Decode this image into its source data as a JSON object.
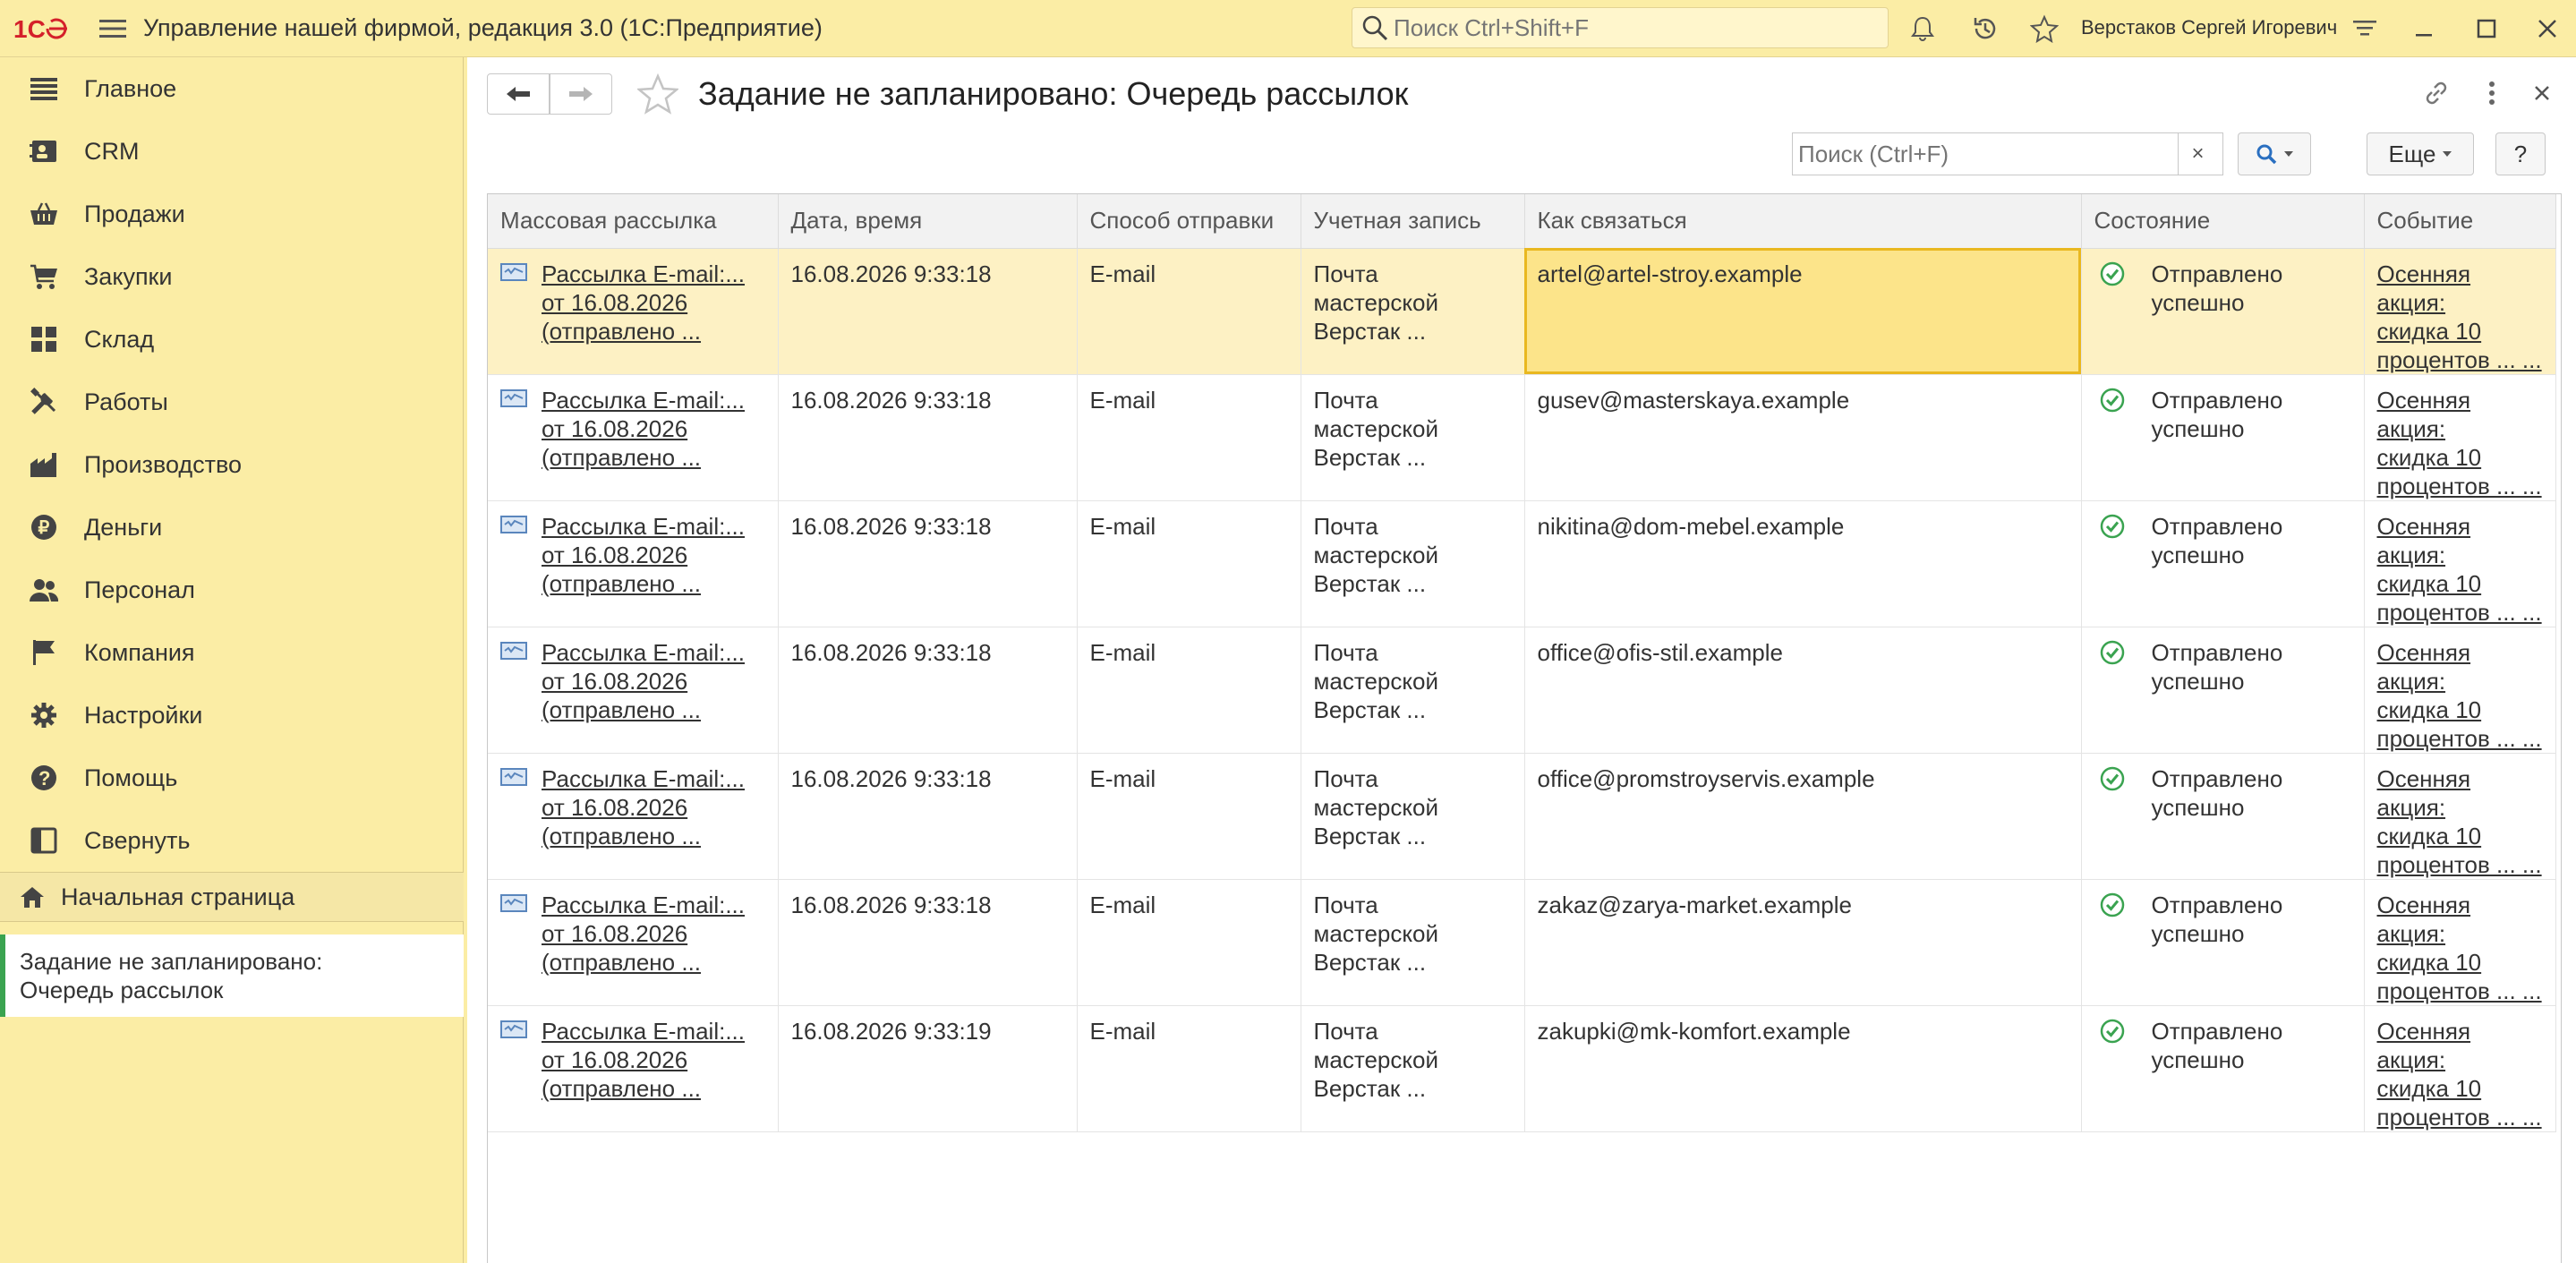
{
  "app": {
    "logo": "1С",
    "title": "Управление нашей фирмой, редакция 3.0  (1С:Предприятие)",
    "search_placeholder": "Поиск Ctrl+Shift+F",
    "user": "Верстаков Сергей Игоревич"
  },
  "sidebar": {
    "items": [
      {
        "label": "Главное",
        "icon": "menu-lines-icon"
      },
      {
        "label": "CRM",
        "icon": "contacts-icon"
      },
      {
        "label": "Продажи",
        "icon": "basket-icon"
      },
      {
        "label": "Закупки",
        "icon": "cart-icon"
      },
      {
        "label": "Склад",
        "icon": "warehouse-grid-icon"
      },
      {
        "label": "Работы",
        "icon": "tools-icon"
      },
      {
        "label": "Производство",
        "icon": "factory-icon"
      },
      {
        "label": "Деньги",
        "icon": "ruble-coin-icon"
      },
      {
        "label": "Персонал",
        "icon": "people-icon"
      },
      {
        "label": "Компания",
        "icon": "flag-icon"
      },
      {
        "label": "Настройки",
        "icon": "gear-icon"
      },
      {
        "label": "Помощь",
        "icon": "help-icon"
      },
      {
        "label": "Свернуть",
        "icon": "collapse-panel-icon"
      }
    ],
    "home": "Начальная страница",
    "open_window": {
      "line1": "Задание не запланировано:",
      "line2": "Очередь рассылок"
    }
  },
  "form": {
    "title": "Задание не запланировано: Очередь рассылок",
    "search_placeholder": "Поиск (Ctrl+F)",
    "clear": "×",
    "more_label": "Еще",
    "help_label": "?"
  },
  "columns": [
    "Массовая рассылка",
    "Дата, время",
    "Способ отправки",
    "Учетная запись",
    "Как связаться",
    "Состояние",
    "Событие"
  ],
  "rows": [
    {
      "mailing": [
        "Рассылка E-mail:...",
        "от 16.08.2026",
        "(отправлено ..."
      ],
      "datetime": "16.08.2026 9:33:18",
      "method": "E-mail",
      "account": [
        "Почта",
        "мастерской",
        "Верстак ..."
      ],
      "contact": "artel@artel-stroy.example",
      "status": [
        "Отправлено",
        "успешно"
      ],
      "event": [
        "Осенняя акция:",
        "скидка 10",
        "процентов ... ..."
      ]
    },
    {
      "mailing": [
        "Рассылка E-mail:...",
        "от 16.08.2026",
        "(отправлено ..."
      ],
      "datetime": "16.08.2026 9:33:18",
      "method": "E-mail",
      "account": [
        "Почта",
        "мастерской",
        "Верстак ..."
      ],
      "contact": "gusev@masterskaya.example",
      "status": [
        "Отправлено",
        "успешно"
      ],
      "event": [
        "Осенняя акция:",
        "скидка 10",
        "процентов ... ..."
      ]
    },
    {
      "mailing": [
        "Рассылка E-mail:...",
        "от 16.08.2026",
        "(отправлено ..."
      ],
      "datetime": "16.08.2026 9:33:18",
      "method": "E-mail",
      "account": [
        "Почта",
        "мастерской",
        "Верстак ..."
      ],
      "contact": "nikitina@dom-mebel.example",
      "status": [
        "Отправлено",
        "успешно"
      ],
      "event": [
        "Осенняя акция:",
        "скидка 10",
        "процентов ... ..."
      ]
    },
    {
      "mailing": [
        "Рассылка E-mail:...",
        "от 16.08.2026",
        "(отправлено ..."
      ],
      "datetime": "16.08.2026 9:33:18",
      "method": "E-mail",
      "account": [
        "Почта",
        "мастерской",
        "Верстак ..."
      ],
      "contact": "office@ofis-stil.example",
      "status": [
        "Отправлено",
        "успешно"
      ],
      "event": [
        "Осенняя акция:",
        "скидка 10",
        "процентов ... ..."
      ]
    },
    {
      "mailing": [
        "Рассылка E-mail:...",
        "от 16.08.2026",
        "(отправлено ..."
      ],
      "datetime": "16.08.2026 9:33:18",
      "method": "E-mail",
      "account": [
        "Почта",
        "мастерской",
        "Верстак ..."
      ],
      "contact": "office@promstroyservis.example",
      "status": [
        "Отправлено",
        "успешно"
      ],
      "event": [
        "Осенняя акция:",
        "скидка 10",
        "процентов ... ..."
      ]
    },
    {
      "mailing": [
        "Рассылка E-mail:...",
        "от 16.08.2026",
        "(отправлено ..."
      ],
      "datetime": "16.08.2026 9:33:18",
      "method": "E-mail",
      "account": [
        "Почта",
        "мастерской",
        "Верстак ..."
      ],
      "contact": "zakaz@zarya-market.example",
      "status": [
        "Отправлено",
        "успешно"
      ],
      "event": [
        "Осенняя акция:",
        "скидка 10",
        "процентов ... ..."
      ]
    },
    {
      "mailing": [
        "Рассылка E-mail:...",
        "от 16.08.2026",
        "(отправлено ..."
      ],
      "datetime": "16.08.2026 9:33:19",
      "method": "E-mail",
      "account": [
        "Почта",
        "мастерской",
        "Верстак ..."
      ],
      "contact": "zakupki@mk-komfort.example",
      "status": [
        "Отправлено",
        "успешно"
      ],
      "event": [
        "Осенняя акция:",
        "скидка 10",
        "процентов ... ..."
      ]
    }
  ],
  "colors": {
    "accent": "#fbeda5",
    "selection": "#fdf1c4",
    "focus": "#e9b820",
    "success": "#3aa350",
    "logo": "#d4202a"
  }
}
